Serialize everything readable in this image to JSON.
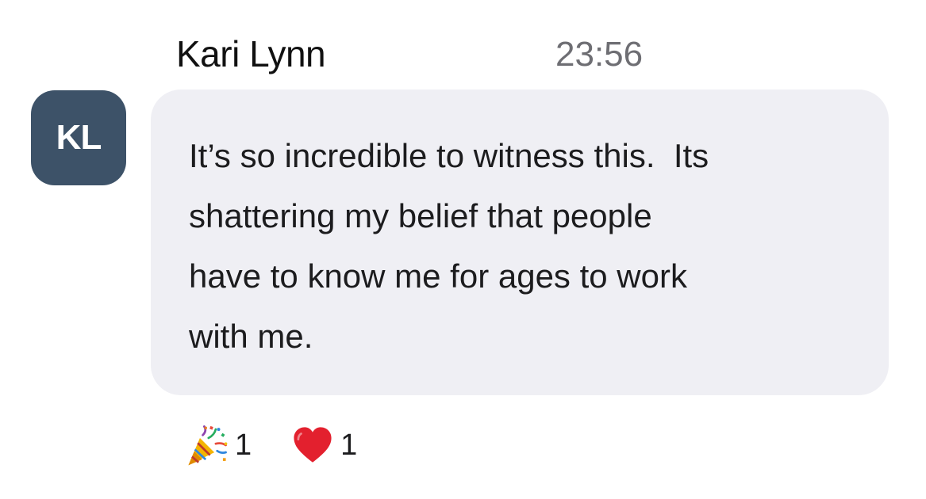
{
  "message": {
    "sender_name": "Kari Lynn",
    "avatar_initials": "KL",
    "timestamp": "23:56",
    "text": "It’s so incredible to witness this.  Its\nshattering my belief that people\nhave to know me for ages to work\nwith me."
  },
  "reactions": [
    {
      "icon": "party-popper-icon",
      "count": "1"
    },
    {
      "icon": "red-heart-icon",
      "count": "1"
    }
  ],
  "colors": {
    "avatar_background": "#3d5268",
    "bubble_background": "#efeff4",
    "timestamp": "#6e6e73",
    "heart": "#e3202e"
  }
}
